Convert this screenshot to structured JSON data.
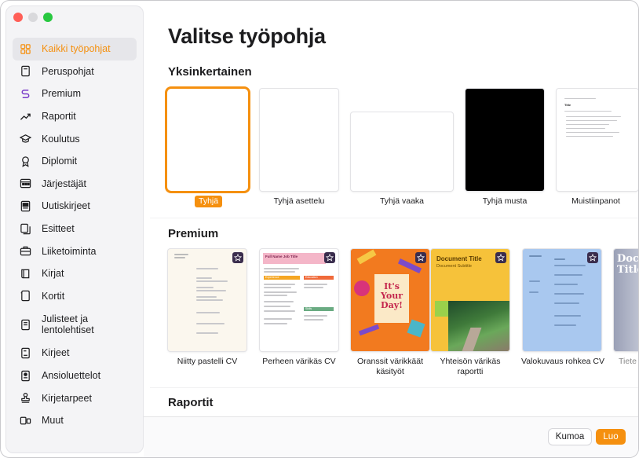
{
  "window": {
    "controls": [
      "close",
      "minimize",
      "maximize"
    ]
  },
  "sidebar": {
    "items": [
      {
        "label": "Kaikki työpohjat",
        "icon": "grid-icon",
        "active": true
      },
      {
        "label": "Peruspohjat",
        "icon": "document-icon"
      },
      {
        "label": "Premium",
        "icon": "premium-icon"
      },
      {
        "label": "Raportit",
        "icon": "trend-icon"
      },
      {
        "label": "Koulutus",
        "icon": "graduation-cap-icon"
      },
      {
        "label": "Diplomit",
        "icon": "ribbon-icon"
      },
      {
        "label": "Järjestäjät",
        "icon": "calendar-icon"
      },
      {
        "label": "Uutiskirjeet",
        "icon": "newspaper-icon"
      },
      {
        "label": "Esitteet",
        "icon": "brochure-icon"
      },
      {
        "label": "Liiketoiminta",
        "icon": "briefcase-icon"
      },
      {
        "label": "Kirjat",
        "icon": "book-icon"
      },
      {
        "label": "Kortit",
        "icon": "card-icon"
      },
      {
        "label": "Julisteet ja lentolehtiset",
        "icon": "poster-icon"
      },
      {
        "label": "Kirjeet",
        "icon": "letter-icon"
      },
      {
        "label": "Ansioluettelot",
        "icon": "resume-icon"
      },
      {
        "label": "Kirjetarpeet",
        "icon": "stamp-icon"
      },
      {
        "label": "Muut",
        "icon": "other-icon"
      }
    ]
  },
  "main": {
    "title": "Valitse työpohja",
    "sections": [
      {
        "title": "Yksinkertainen",
        "templates": [
          {
            "label": "Tyhjä",
            "selected": true
          },
          {
            "label": "Tyhjä asettelu"
          },
          {
            "label": "Tyhjä vaaka"
          },
          {
            "label": "Tyhjä musta"
          },
          {
            "label": "Muistiinpanot"
          }
        ],
        "note_title": "Title"
      },
      {
        "title": "Premium",
        "templates": [
          {
            "label": "Niitty pastelli CV"
          },
          {
            "label": "Perheen värikäs CV"
          },
          {
            "label": "Oranssit värikkäät käsityöt",
            "thumb_text": "It's Your Day!"
          },
          {
            "label": "Yhteisön värikäs raportti",
            "thumb_title": "Document Title",
            "thumb_subtitle": "Document Subtitle"
          },
          {
            "label": "Valokuvaus rohkea CV"
          },
          {
            "label": "Tiete",
            "thumb_text": "Docu Title"
          }
        ],
        "cv2_name": "Full Name Job Title",
        "cv2_sections": [
          "Experience",
          "Education",
          "Skills"
        ]
      },
      {
        "title": "Raportit"
      }
    ]
  },
  "footer": {
    "cancel_label": "Kumoa",
    "create_label": "Luo"
  },
  "colors": {
    "accent": "#f5900f",
    "sidebar_bg": "#f4f4f6"
  }
}
